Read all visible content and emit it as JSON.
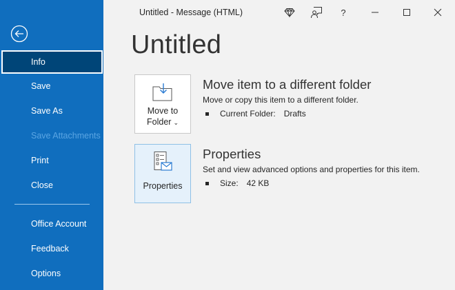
{
  "window": {
    "title": "Untitled  -  Message (HTML)",
    "help_label": "?"
  },
  "sidebar": {
    "items": [
      {
        "label": "Info",
        "state": "selected"
      },
      {
        "label": "Save",
        "state": "normal"
      },
      {
        "label": "Save As",
        "state": "normal"
      },
      {
        "label": "Save Attachments",
        "state": "disabled"
      },
      {
        "label": "Print",
        "state": "normal"
      },
      {
        "label": "Close",
        "state": "normal"
      },
      {
        "label": "Office Account",
        "state": "normal"
      },
      {
        "label": "Feedback",
        "state": "normal"
      },
      {
        "label": "Options",
        "state": "normal"
      }
    ]
  },
  "main": {
    "title": "Untitled",
    "sections": [
      {
        "tile_label_line1": "Move to",
        "tile_label_line2": "Folder",
        "tile_icon": "move-to-folder-icon",
        "heading": "Move item to a different folder",
        "description": "Move or copy this item to a different folder.",
        "detail_key": "Current Folder:",
        "detail_value": "Drafts"
      },
      {
        "tile_label_line1": "Properties",
        "tile_icon": "properties-icon",
        "heading": "Properties",
        "description": "Set and view advanced options and properties for this item.",
        "detail_key": "Size:",
        "detail_value": "42 KB"
      }
    ]
  },
  "colors": {
    "sidebar_bg": "#106ebe",
    "sidebar_selected": "#004578",
    "content_bg": "#f2f2f2",
    "tile_active_bg": "#e5f1fb"
  }
}
